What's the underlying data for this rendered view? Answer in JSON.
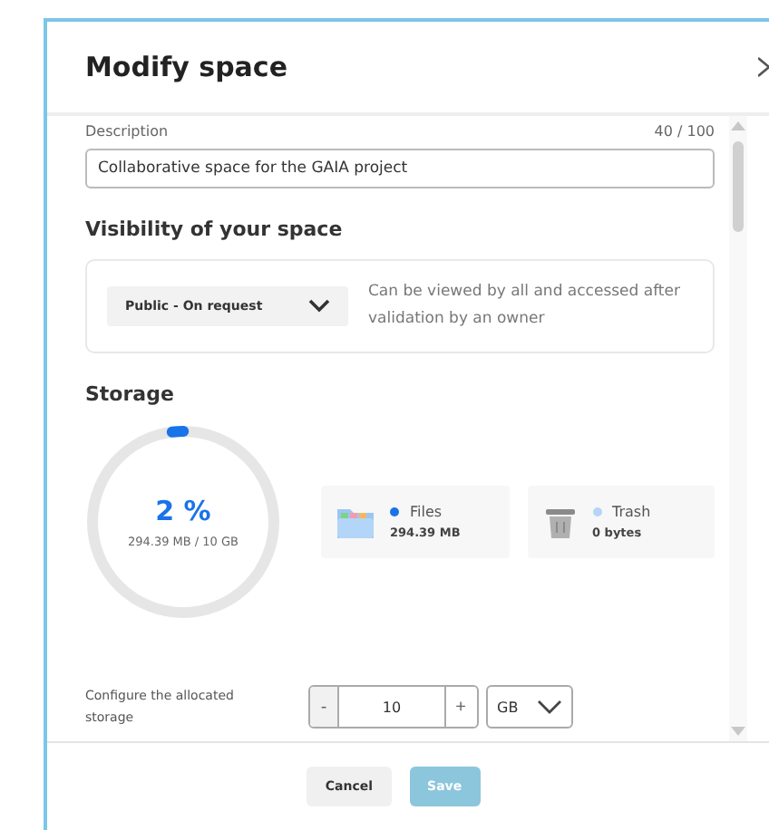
{
  "dialog": {
    "title": "Modify space"
  },
  "description": {
    "label": "Description",
    "counter": "40 / 100",
    "value": "Collaborative space for the GAIA project"
  },
  "visibility": {
    "heading": "Visibility of your space",
    "selected_option": "Public - On request",
    "hint": "Can be viewed by all and accessed after validation by an owner"
  },
  "storage": {
    "heading": "Storage",
    "level": 0.02,
    "percent": "2 %",
    "usage": "294.39 MB / 10 GB",
    "categories": [
      {
        "kind": "files",
        "name": "Files",
        "size": "294.39 MB",
        "color": "#1a73e8"
      },
      {
        "kind": "trash",
        "name": "Trash",
        "size": "0 bytes",
        "color": "#b7d3f5"
      }
    ]
  },
  "allocation": {
    "label": "Configure the allocated storage",
    "minus": "-",
    "value": "10",
    "plus": "+",
    "unit": "GB"
  },
  "buttons": [
    {
      "kind": "cancel",
      "label": "Cancel",
      "disabled": false
    },
    {
      "kind": "save",
      "label": "Save",
      "disabled": true
    }
  ]
}
